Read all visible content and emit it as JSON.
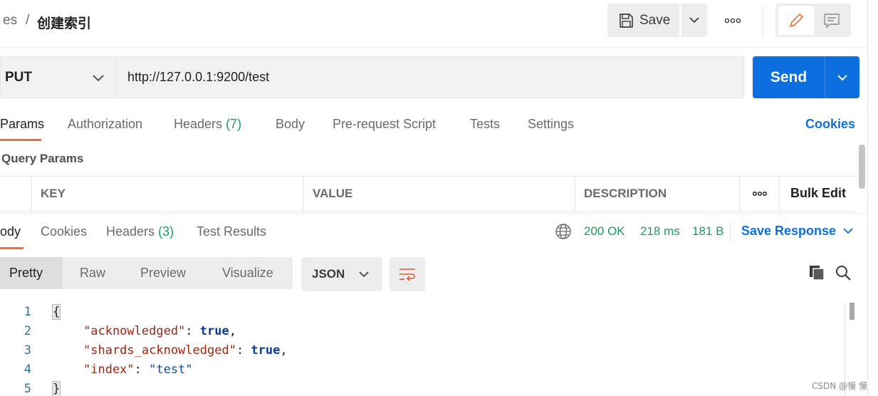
{
  "breadcrumb": {
    "root": "es",
    "separator": "/",
    "title": "创建索引"
  },
  "header": {
    "save_label": "Save"
  },
  "request": {
    "method": "PUT",
    "url": "http://127.0.0.1:9200/test",
    "send_label": "Send"
  },
  "request_tabs": {
    "params": "Params",
    "authorization": "Authorization",
    "headers": "Headers",
    "headers_count": "(7)",
    "body": "Body",
    "prerequest": "Pre-request Script",
    "tests": "Tests",
    "settings": "Settings",
    "cookies": "Cookies"
  },
  "params": {
    "section_label": "Query Params",
    "columns": [
      "KEY",
      "VALUE",
      "DESCRIPTION"
    ],
    "bulk_edit": "Bulk Edit"
  },
  "response_tabs": {
    "body": "ody",
    "cookies": "Cookies",
    "headers": "Headers",
    "headers_count": "(3)",
    "test_results": "Test Results"
  },
  "response_meta": {
    "status": "200 OK",
    "time": "218 ms",
    "size": "181 B",
    "save_response": "Save Response"
  },
  "views": {
    "pretty": "Pretty",
    "raw": "Raw",
    "preview": "Preview",
    "visualize": "Visualize",
    "format": "JSON"
  },
  "code": {
    "line_numbers": [
      "1",
      "2",
      "3",
      "4",
      "5"
    ],
    "line1": "{",
    "key1": "\"acknowledged\"",
    "val1": "true",
    "key2": "\"shards_acknowledged\"",
    "val2": "true",
    "key3": "\"index\"",
    "val3": "\"test\"",
    "line5": "}",
    "colon": ": ",
    "comma": ","
  },
  "watermark": "CSDN @慢 慢",
  "colors": {
    "accent": "#0d6edf",
    "tab_active": "#f26b3a",
    "success": "#1d9a5b"
  }
}
